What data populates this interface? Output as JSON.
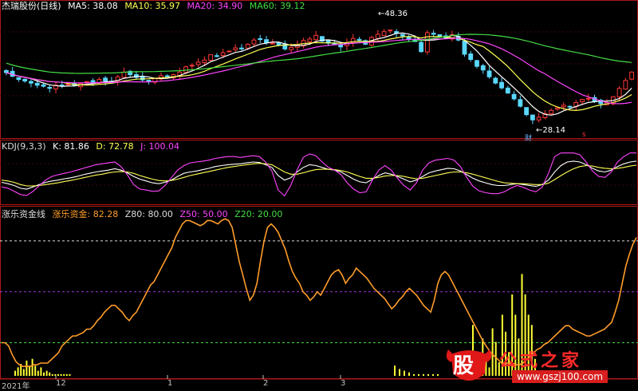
{
  "header": {
    "stock_name": "杰瑞股份(日线)",
    "ma": [
      {
        "label": "MA5: 38.08",
        "color": "#ffffff"
      },
      {
        "label": "MA10: 35.97",
        "color": "#ffff55"
      },
      {
        "label": "MA20: 34.90",
        "color": "#ff44ff"
      },
      {
        "label": "MA60: 39.12",
        "color": "#44dd44"
      }
    ],
    "high_label": "48.36",
    "low_label": "28.14",
    "fin_marker": "财",
    "s_marker": "s"
  },
  "kdj": {
    "title": "KDJ(9,3,3)",
    "k": "K: 81.86",
    "d": "D: 72.78",
    "j": "J: 100.04"
  },
  "zl": {
    "title": "涨乐资金线",
    "main": "涨乐资金: 82.28",
    "z80": "Z80: 80.00",
    "z50": "Z50: 50.00",
    "z20": "Z20: 20.00"
  },
  "x_axis": [
    "2021年",
    "12",
    "1",
    "2",
    "3"
  ],
  "watermark": {
    "cow": "股",
    "site": "公式之家",
    "url": "www.gszj100.com"
  },
  "colors": {
    "up": "#ff3838",
    "down": "#5ad8ff",
    "ma5": "#ffffff",
    "ma10": "#ffff55",
    "ma20": "#ff44ff",
    "ma60": "#44dd44",
    "k": "#ffffff",
    "d": "#ffff55",
    "j": "#ff44ff",
    "zl_line": "#ff9d2a",
    "bars": "#ffff33",
    "frame": "#b01818"
  },
  "chart_data": [
    {
      "type": "candlestick",
      "title": "杰瑞股份(日线)",
      "ylim": [
        26,
        50
      ],
      "closes": [
        38,
        37.3,
        36.7,
        36.4,
        36.0,
        35.6,
        35.4,
        35.0,
        35.6,
        35.4,
        35.8,
        35.5,
        35.9,
        36.3,
        36.0,
        36.7,
        36.4,
        36.2,
        37.2,
        38.1,
        37.6,
        37.1,
        36.6,
        36.4,
        36.9,
        37.4,
        37.3,
        37.6,
        38.1,
        39.1,
        39.4,
        40.0,
        40.4,
        41.4,
        41.2,
        41.8,
        42.1,
        42.7,
        42.5,
        43.4,
        44.2,
        44.3,
        43.7,
        43.6,
        43.3,
        42.5,
        42.8,
        43.3,
        44.1,
        44.4,
        45.1,
        44.0,
        43.6,
        43.3,
        42.9,
        43.7,
        44.5,
        44.2,
        43.4,
        44.7,
        45.3,
        45.8,
        46.1,
        45.5,
        45.0,
        44.3,
        43.9,
        42.0,
        45.6,
        45.3,
        45.0,
        44.6,
        45.2,
        44.2,
        41.5,
        40.5,
        39.2,
        38.5,
        37.2,
        36.0,
        35.1,
        34.1,
        33.0,
        31.6,
        30.0,
        29.0,
        29.5,
        30.2,
        30.8,
        31.3,
        31.8,
        31.5,
        32.3,
        32.9,
        33.1,
        32.5,
        32.1,
        32.3,
        33.4,
        35.0,
        36.5,
        38.1
      ],
      "high": 48.36,
      "low": 28.14,
      "series": [
        {
          "name": "MA5",
          "value": 38.08
        },
        {
          "name": "MA10",
          "value": 35.97
        },
        {
          "name": "MA20",
          "value": 34.9
        },
        {
          "name": "MA60",
          "value": 39.12
        }
      ]
    },
    {
      "type": "line",
      "title": "KDJ(9,3,3)",
      "ylim": [
        -10,
        110
      ],
      "series": [
        {
          "name": "K",
          "values": [
            35,
            32,
            28,
            22,
            20,
            25,
            30,
            35,
            38,
            40,
            43,
            45,
            48,
            52,
            55,
            58,
            60,
            62,
            65,
            62,
            56,
            48,
            42,
            38,
            34,
            32,
            35,
            40,
            48,
            55,
            58,
            60,
            63,
            66,
            70,
            72,
            74,
            75,
            76,
            78,
            80,
            79,
            74,
            68,
            50,
            40,
            45,
            58,
            68,
            74,
            72,
            68,
            64,
            62,
            58,
            50,
            42,
            36,
            34,
            42,
            50,
            56,
            53,
            48,
            42,
            36,
            40,
            48,
            56,
            60,
            63,
            66,
            65,
            60,
            52,
            44,
            38,
            34,
            30,
            28,
            28,
            30,
            32,
            30,
            28,
            26,
            30,
            40,
            58,
            72,
            80,
            82,
            80,
            74,
            66,
            60,
            58,
            62,
            70,
            76,
            80,
            82
          ]
        },
        {
          "name": "D",
          "values": [
            40,
            38,
            35,
            30,
            27,
            27,
            28,
            30,
            32,
            34,
            37,
            39,
            42,
            45,
            48,
            51,
            53,
            56,
            58,
            59,
            58,
            55,
            50,
            46,
            42,
            39,
            38,
            39,
            42,
            46,
            50,
            53,
            56,
            59,
            62,
            65,
            68,
            70,
            72,
            74,
            76,
            77,
            76,
            74,
            66,
            58,
            53,
            53,
            56,
            60,
            63,
            64,
            64,
            63,
            61,
            58,
            53,
            48,
            44,
            44,
            46,
            49,
            50,
            50,
            48,
            45,
            43,
            44,
            47,
            50,
            53,
            56,
            58,
            58,
            56,
            53,
            49,
            45,
            41,
            37,
            34,
            33,
            32,
            32,
            31,
            30,
            30,
            33,
            41,
            50,
            58,
            65,
            70,
            72,
            71,
            68,
            66,
            65,
            66,
            68,
            71,
            73
          ]
        },
        {
          "name": "J",
          "values": [
            25,
            22,
            15,
            8,
            6,
            15,
            28,
            40,
            48,
            52,
            55,
            58,
            62,
            66,
            70,
            74,
            76,
            78,
            80,
            70,
            52,
            30,
            20,
            18,
            15,
            16,
            28,
            45,
            62,
            72,
            78,
            80,
            82,
            84,
            88,
            90,
            92,
            92,
            90,
            92,
            94,
            92,
            80,
            60,
            18,
            5,
            28,
            62,
            90,
            98,
            94,
            80,
            68,
            62,
            52,
            34,
            20,
            12,
            14,
            40,
            62,
            72,
            62,
            44,
            28,
            18,
            34,
            62,
            78,
            84,
            86,
            88,
            84,
            70,
            46,
            26,
            16,
            12,
            10,
            10,
            14,
            22,
            28,
            24,
            18,
            14,
            24,
            55,
            92,
            100,
            100,
            100,
            96,
            80,
            60,
            48,
            46,
            58,
            80,
            92,
            100,
            100
          ]
        }
      ],
      "k": 81.86,
      "d": 72.78,
      "j": 100.04
    },
    {
      "type": "line",
      "title": "涨乐资金线",
      "ylim": [
        0,
        95
      ],
      "series": [
        {
          "name": "涨乐资金",
          "values": [
            20,
            20,
            18,
            13,
            9,
            7,
            6,
            6,
            6,
            7,
            7,
            8,
            8,
            8,
            10,
            12,
            14,
            18,
            20,
            22,
            24,
            24,
            25,
            26,
            28,
            28,
            30,
            33,
            35,
            38,
            40,
            42,
            42,
            40,
            38,
            35,
            33,
            36,
            38,
            42,
            46,
            50,
            54,
            56,
            60,
            64,
            68,
            72,
            76,
            82,
            86,
            90,
            92,
            92,
            91,
            90,
            89,
            90,
            92,
            92,
            91,
            90,
            92,
            93,
            92,
            88,
            78,
            68,
            60,
            52,
            45,
            48,
            55,
            68,
            80,
            88,
            90,
            88,
            85,
            80,
            75,
            68,
            62,
            58,
            55,
            50,
            48,
            45,
            47,
            50,
            48,
            52,
            56,
            60,
            62,
            63,
            60,
            55,
            58,
            60,
            64,
            62,
            60,
            58,
            55,
            52,
            50,
            48,
            46,
            43,
            40,
            42,
            45,
            47,
            50,
            52,
            50,
            48,
            45,
            42,
            40,
            38,
            45,
            55,
            60,
            62,
            60,
            56,
            52,
            48,
            44,
            40,
            36,
            32,
            28,
            24,
            20,
            17,
            14,
            12,
            10,
            8,
            8,
            8,
            8,
            7,
            7,
            8,
            10,
            12,
            14,
            16,
            17,
            19,
            20,
            22,
            24,
            26,
            28,
            30,
            30,
            28,
            27,
            26,
            25,
            24,
            24,
            25,
            26,
            27,
            28,
            30,
            32,
            38,
            45,
            55,
            65,
            72,
            78,
            82
          ]
        },
        {
          "name": "Z80",
          "value": 80.0
        },
        {
          "name": "Z50",
          "value": 50.0
        },
        {
          "name": "Z20",
          "value": 20.0
        }
      ],
      "bars_left": [
        3,
        5,
        7,
        4,
        9,
        6,
        10,
        6,
        3,
        5,
        2,
        3,
        2,
        1,
        1,
        1,
        1,
        1,
        1,
        1
      ],
      "bars_mid": [
        6,
        4,
        3,
        2,
        1,
        1,
        1,
        1,
        1,
        1
      ],
      "bars_right": [
        30,
        12,
        4,
        22,
        12,
        5,
        28,
        20,
        8,
        36,
        26,
        14,
        48,
        36,
        22,
        60,
        48,
        36,
        30,
        10
      ]
    }
  ]
}
